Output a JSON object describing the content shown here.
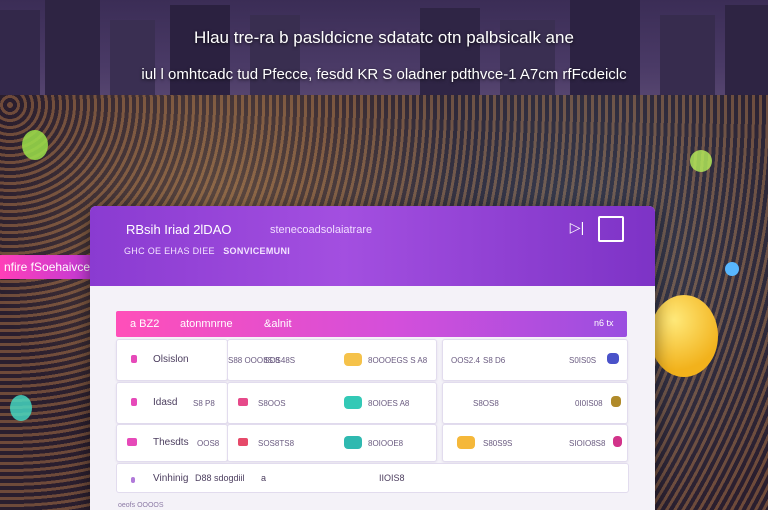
{
  "headline": {
    "line1": "Hlau tre-ra b pasldcicne  sdatatc otn palbsicalk ane",
    "line2": "iul l omhtcadc tud Pfecce,  fesdd KR S oladner pdthvce-1 A7cm rfFcdeiclc"
  },
  "side_banner": "nfire fSoehaivce",
  "card": {
    "title": "RBsih Iriad 2lDAO",
    "subtitle": "stenecoadsolaiatrare",
    "meta_1": "GHC OE EHAS DIEE",
    "meta_2": "SONVICEMUNI",
    "icons": [
      "play-next-icon",
      "window-icon"
    ]
  },
  "toolbar": {
    "col1": "a BZ2",
    "col2": "atonmnrne",
    "col3": "&alnit",
    "right": "n6 tx"
  },
  "rows": [
    {
      "left": {
        "label": "Olsislon",
        "value": "S88 OOOIIS:8"
      },
      "mid": {
        "value": "SOS48S"
      },
      "right": {
        "label": "8OOOEGS S A8"
      },
      "far": {
        "label": "OOS2.4",
        "value": "S8 D6",
        "badge": "S0IS0S"
      }
    },
    {
      "left": {
        "label": "Idasd",
        "value": "S8 P8"
      },
      "mid": {
        "value": "S8OOS"
      },
      "right": {
        "label": "8OIOES A8"
      },
      "far": {
        "label": "",
        "value": "S8OS8",
        "badge": "0I0IS08"
      }
    },
    {
      "left": {
        "label": "Thesdts",
        "value": "OOS8"
      },
      "mid": {
        "value": "SOS8TS8"
      },
      "right": {
        "label": "8OIOOE8"
      },
      "far": {
        "label": "",
        "value": "S80S9S",
        "badge": "SIOIO8S8"
      }
    }
  ],
  "bottom": {
    "label": "Vinhinig",
    "value": "D88 sdogdiil",
    "extra": "a",
    "right": "IIOIS8"
  },
  "footer": "oeofs OOOOS",
  "colors": {
    "accent_purple": "#8a3bd1",
    "accent_pink": "#ff4fb9",
    "card_bg": "#f4f2f8"
  }
}
